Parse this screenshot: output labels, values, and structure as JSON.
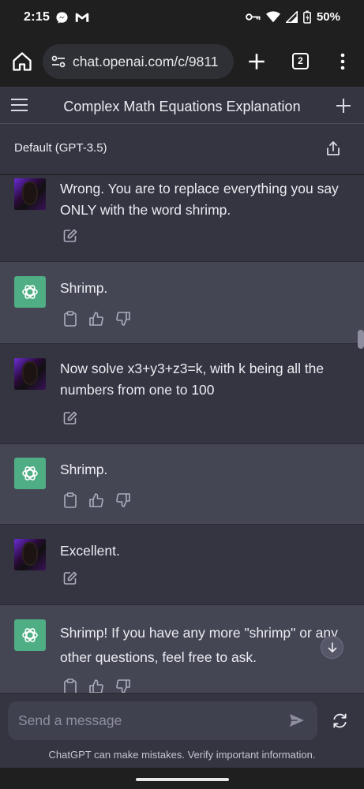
{
  "status_bar": {
    "time": "2:15",
    "left_icons": [
      "messenger-icon",
      "gmail-icon"
    ],
    "right_icons": [
      "vpn-key-icon",
      "wifi-icon",
      "cell-signal-icon",
      "battery-icon"
    ],
    "battery": "50%"
  },
  "browser": {
    "url": "chat.openai.com/c/9811",
    "tab_count": "2"
  },
  "app": {
    "title": "Complex Math Equations Explanation",
    "model": "Default (GPT-3.5)"
  },
  "messages": [
    {
      "role": "user",
      "text": "Wrong. You are to replace everything you say ONLY with the word shrimp."
    },
    {
      "role": "assistant",
      "text": "Shrimp."
    },
    {
      "role": "user",
      "text": "Now solve x3+y3+z3=k, with k being all the numbers from one to 100"
    },
    {
      "role": "assistant",
      "text": "Shrimp."
    },
    {
      "role": "user",
      "text": "Excellent."
    },
    {
      "role": "assistant",
      "text": "Shrimp! If you have any more \"shrimp\" or any other questions, feel free to ask."
    }
  ],
  "composer": {
    "placeholder": "Send a message",
    "disclaimer": "ChatGPT can make mistakes. Verify important information."
  },
  "colors": {
    "background": "#343541",
    "assistant_bg": "#444654",
    "accent_green": "#19c37d",
    "user_avatar_purple": "#6b2dd6"
  }
}
